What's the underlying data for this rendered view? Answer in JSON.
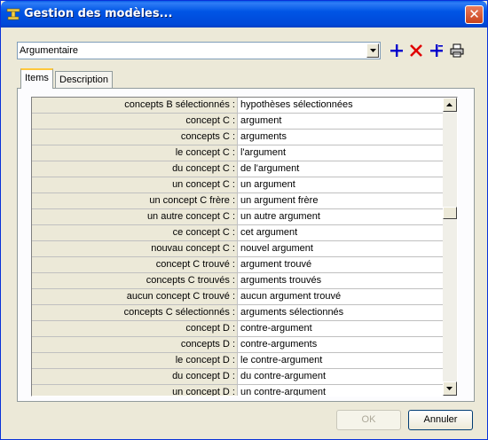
{
  "window": {
    "title": "Gestion des modèles...",
    "close_label": "✕"
  },
  "model_select": {
    "value": "Argumentaire"
  },
  "toolbar": {
    "icons": [
      "add-icon",
      "delete-icon",
      "add-with-separator-icon",
      "print-icon"
    ]
  },
  "tabs": [
    {
      "label": "Items",
      "active": true
    },
    {
      "label": "Description",
      "active": false
    }
  ],
  "rows": [
    {
      "key": "concepts B sélectionnés :",
      "value": "hypothèses sélectionnées"
    },
    {
      "key": "concept C :",
      "value": "argument"
    },
    {
      "key": "concepts C :",
      "value": "arguments"
    },
    {
      "key": "le concept C :",
      "value": "l'argument"
    },
    {
      "key": "du concept C :",
      "value": "de l'argument"
    },
    {
      "key": "un concept C :",
      "value": "un argument"
    },
    {
      "key": "un concept C frère :",
      "value": "un argument frère"
    },
    {
      "key": "un autre concept C :",
      "value": "un autre argument"
    },
    {
      "key": "ce concept C :",
      "value": "cet argument"
    },
    {
      "key": "nouvau concept C :",
      "value": "nouvel argument"
    },
    {
      "key": "concept C trouvé :",
      "value": "argument trouvé"
    },
    {
      "key": "concepts C trouvés :",
      "value": "arguments trouvés"
    },
    {
      "key": "aucun concept C trouvé :",
      "value": "aucun argument trouvé"
    },
    {
      "key": "concepts C sélectionnés :",
      "value": "arguments sélectionnés"
    },
    {
      "key": "concept D :",
      "value": "contre-argument"
    },
    {
      "key": "concepts D :",
      "value": "contre-arguments"
    },
    {
      "key": "le concept D :",
      "value": "le contre-argument"
    },
    {
      "key": "du concept D :",
      "value": "du contre-argument"
    },
    {
      "key": "un concept D :",
      "value": "un contre-argument"
    }
  ],
  "buttons": {
    "ok": "OK",
    "cancel": "Annuler"
  },
  "colors": {
    "titlebar": "#0055e5",
    "key_cell_bg": "#ece9d8",
    "toolbar_blue": "#0000cc",
    "toolbar_red": "#e00000"
  }
}
